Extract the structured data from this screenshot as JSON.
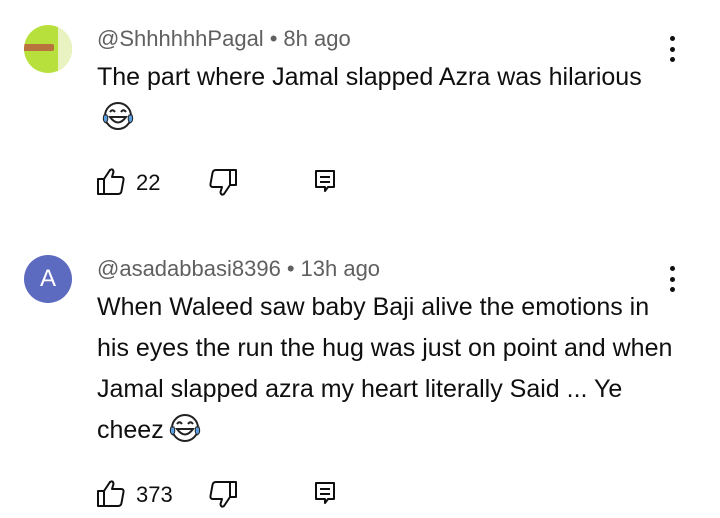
{
  "comments": [
    {
      "author": "@ShhhhhhPagal",
      "separator": "•",
      "time": "8h ago",
      "text": "The part where Jamal slapped Azra was hilarious",
      "likes": "22",
      "avatar_colors": {
        "bg": "#b8e03c",
        "bar": "#b9733e",
        "light": "#e9f3c2"
      },
      "emoji_icon": "face-with-tears-of-joy-icon"
    },
    {
      "author": "@asadabbasi8396",
      "separator": "•",
      "time": "13h ago",
      "avatar_letter": "A",
      "avatar_color": "#5c6bc0",
      "text": "When Waleed saw baby Baji alive the emotions in his eyes the run the hug was just on point and when Jamal slapped azra my heart literally Said ... Ye cheez",
      "likes": "373",
      "emoji_icon": "face-with-tears-of-joy-icon"
    }
  ],
  "icons": {
    "like": "thumbs-up-icon",
    "dislike": "thumbs-down-icon",
    "reply": "reply-icon",
    "more": "more-vertical-icon"
  }
}
